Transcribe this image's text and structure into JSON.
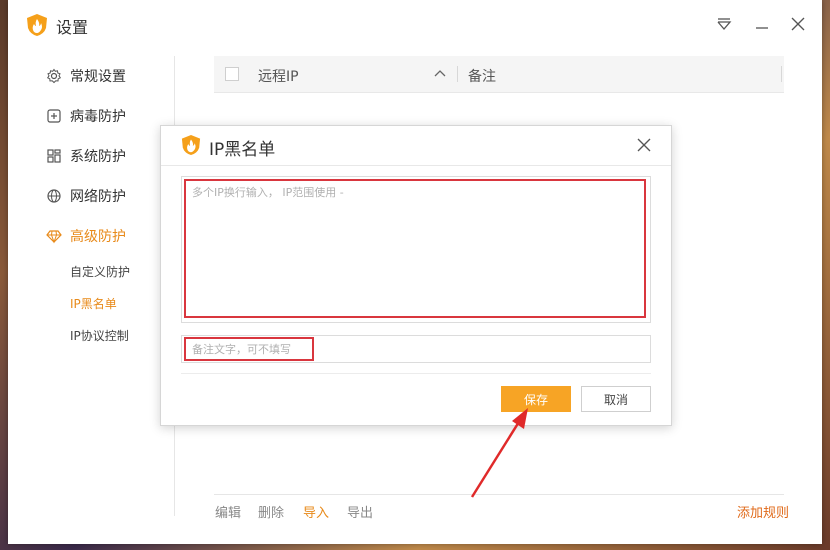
{
  "window": {
    "title": "设置",
    "controls": {
      "menu_icon": "menu-dropdown-icon",
      "minimize_icon": "minimize-icon",
      "close_icon": "close-icon"
    }
  },
  "sidebar": {
    "items": [
      {
        "label": "常规设置",
        "icon": "gear-icon"
      },
      {
        "label": "病毒防护",
        "icon": "plus-square-icon"
      },
      {
        "label": "系统防护",
        "icon": "grid-icon"
      },
      {
        "label": "网络防护",
        "icon": "globe-icon"
      },
      {
        "label": "高级防护",
        "icon": "diamond-icon",
        "active": true
      }
    ],
    "subitems": [
      {
        "label": "自定义防护"
      },
      {
        "label": "IP黑名单",
        "active": true
      },
      {
        "label": "IP协议控制"
      }
    ]
  },
  "table": {
    "headers": {
      "ip": "远程IP",
      "note": "备注"
    }
  },
  "footer": {
    "edit": "编辑",
    "delete": "删除",
    "import": "导入",
    "export": "导出",
    "add_rule": "添加规则"
  },
  "dialog": {
    "title": "IP黑名单",
    "ip_placeholder": "多个IP换行输入， IP范围使用 -",
    "note_placeholder": "备注文字，可不填写",
    "save_label": "保存",
    "cancel_label": "取消"
  },
  "colors": {
    "accent": "#e88a1a",
    "save_button": "#f7a425",
    "highlight": "#d9363e"
  }
}
